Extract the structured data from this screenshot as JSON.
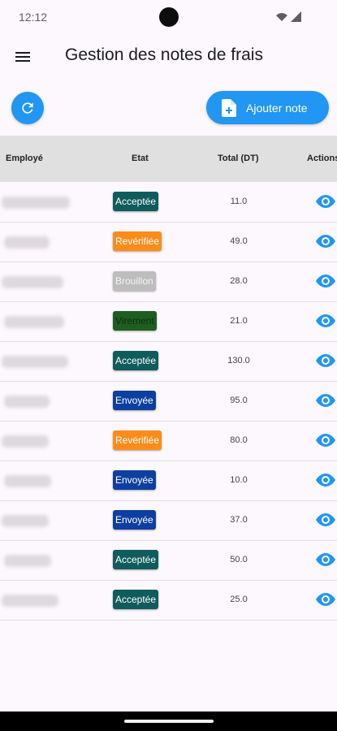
{
  "status_bar": {
    "time": "12:12"
  },
  "app_bar": {
    "title": "Gestion des notes de frais"
  },
  "actions": {
    "add_label": "Ajouter note"
  },
  "table": {
    "columns": [
      "Employé",
      "Etat",
      "Total (DT)",
      "Actions"
    ],
    "rows": [
      {
        "status": "Acceptée",
        "total": "11.0"
      },
      {
        "status": "Revérifiée",
        "total": "49.0"
      },
      {
        "status": "Brouillon",
        "total": "28.0"
      },
      {
        "status": "Virement",
        "total": "21.0"
      },
      {
        "status": "Acceptée",
        "total": "130.0"
      },
      {
        "status": "Envoyée",
        "total": "95.0"
      },
      {
        "status": "Revérifiée",
        "total": "80.0"
      },
      {
        "status": "Envoyée",
        "total": "10.0"
      },
      {
        "status": "Envoyée",
        "total": "37.0"
      },
      {
        "status": "Acceptée",
        "total": "50.0"
      },
      {
        "status": "Acceptée",
        "total": "25.0"
      }
    ]
  },
  "status_colors": {
    "Acceptée": {
      "bg": "#0f5c5c",
      "fg": "#ffffff"
    },
    "Revérifiée": {
      "bg": "#fb8c1a",
      "fg": "#ffffff"
    },
    "Brouillon": {
      "bg": "#bdbdbd",
      "fg": "#f4f4f4"
    },
    "Virement": {
      "bg": "#1e5e20",
      "fg": "#0c2e0c"
    },
    "Envoyée": {
      "bg": "#0d3fa1",
      "fg": "#ffffff"
    }
  },
  "colors": {
    "accent": "#2196f3",
    "header_bg": "#e0e0e0",
    "page_bg": "#fdf8fd"
  },
  "icons": {
    "menu": "hamburger-menu-icon",
    "refresh": "refresh-icon",
    "add": "file-plus-icon",
    "view": "eye-icon"
  }
}
